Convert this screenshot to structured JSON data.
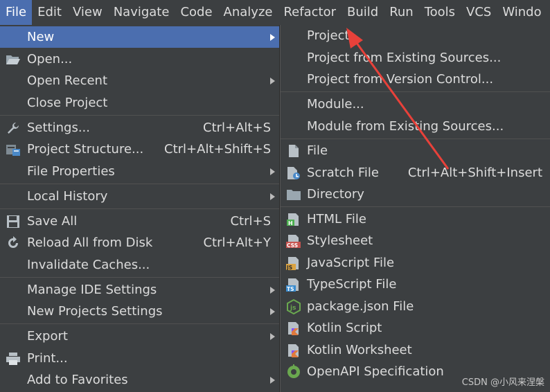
{
  "menubar": {
    "items": [
      "File",
      "Edit",
      "View",
      "Navigate",
      "Code",
      "Analyze",
      "Refactor",
      "Build",
      "Run",
      "Tools",
      "VCS",
      "Windo"
    ]
  },
  "file_menu": {
    "items": [
      {
        "label": "New",
        "shortcut": "",
        "submenu": true,
        "icon": "none"
      },
      {
        "label": "Open...",
        "shortcut": "",
        "submenu": false,
        "icon": "folder-open-icon"
      },
      {
        "label": "Open Recent",
        "shortcut": "",
        "submenu": true,
        "icon": "none"
      },
      {
        "label": "Close Project",
        "shortcut": "",
        "submenu": false,
        "icon": "none"
      },
      {
        "label": "Settings...",
        "shortcut": "Ctrl+Alt+S",
        "submenu": false,
        "icon": "wrench-icon"
      },
      {
        "label": "Project Structure...",
        "shortcut": "Ctrl+Alt+Shift+S",
        "submenu": false,
        "icon": "project-structure-icon"
      },
      {
        "label": "File Properties",
        "shortcut": "",
        "submenu": true,
        "icon": "none"
      },
      {
        "label": "Local History",
        "shortcut": "",
        "submenu": true,
        "icon": "none"
      },
      {
        "label": "Save All",
        "shortcut": "Ctrl+S",
        "submenu": false,
        "icon": "save-icon"
      },
      {
        "label": "Reload All from Disk",
        "shortcut": "Ctrl+Alt+Y",
        "submenu": false,
        "icon": "reload-icon"
      },
      {
        "label": "Invalidate Caches...",
        "shortcut": "",
        "submenu": false,
        "icon": "none"
      },
      {
        "label": "Manage IDE Settings",
        "shortcut": "",
        "submenu": true,
        "icon": "none"
      },
      {
        "label": "New Projects Settings",
        "shortcut": "",
        "submenu": true,
        "icon": "none"
      },
      {
        "label": "Export",
        "shortcut": "",
        "submenu": true,
        "icon": "none"
      },
      {
        "label": "Print...",
        "shortcut": "",
        "submenu": false,
        "icon": "printer-icon"
      },
      {
        "label": "Add to Favorites",
        "shortcut": "",
        "submenu": true,
        "icon": "none"
      }
    ]
  },
  "new_submenu": {
    "items": [
      {
        "label": "Project...",
        "shortcut": "",
        "icon": "none"
      },
      {
        "label": "Project from Existing Sources...",
        "shortcut": "",
        "icon": "none"
      },
      {
        "label": "Project from Version Control...",
        "shortcut": "",
        "icon": "none"
      },
      {
        "label": "Module...",
        "shortcut": "",
        "icon": "none"
      },
      {
        "label": "Module from Existing Sources...",
        "shortcut": "",
        "icon": "none"
      },
      {
        "label": "File",
        "shortcut": "",
        "icon": "file-icon"
      },
      {
        "label": "Scratch File",
        "shortcut": "Ctrl+Alt+Shift+Insert",
        "icon": "scratch-file-icon"
      },
      {
        "label": "Directory",
        "shortcut": "",
        "icon": "folder-icon"
      },
      {
        "label": "HTML File",
        "shortcut": "",
        "icon": "html-file-icon"
      },
      {
        "label": "Stylesheet",
        "shortcut": "",
        "icon": "css-file-icon"
      },
      {
        "label": "JavaScript File",
        "shortcut": "",
        "icon": "js-file-icon"
      },
      {
        "label": "TypeScript File",
        "shortcut": "",
        "icon": "ts-file-icon"
      },
      {
        "label": "package.json File",
        "shortcut": "",
        "icon": "nodejs-icon"
      },
      {
        "label": "Kotlin Script",
        "shortcut": "",
        "icon": "kotlin-script-icon"
      },
      {
        "label": "Kotlin Worksheet",
        "shortcut": "",
        "icon": "kotlin-worksheet-icon"
      },
      {
        "label": "OpenAPI Specification",
        "shortcut": "",
        "icon": "openapi-icon"
      }
    ]
  },
  "watermark": "CSDN @小风来涅槃",
  "colors": {
    "menu_bg": "#3c3f41",
    "selection": "#4b6eaf",
    "annotation_arrow": "#e8413a"
  }
}
